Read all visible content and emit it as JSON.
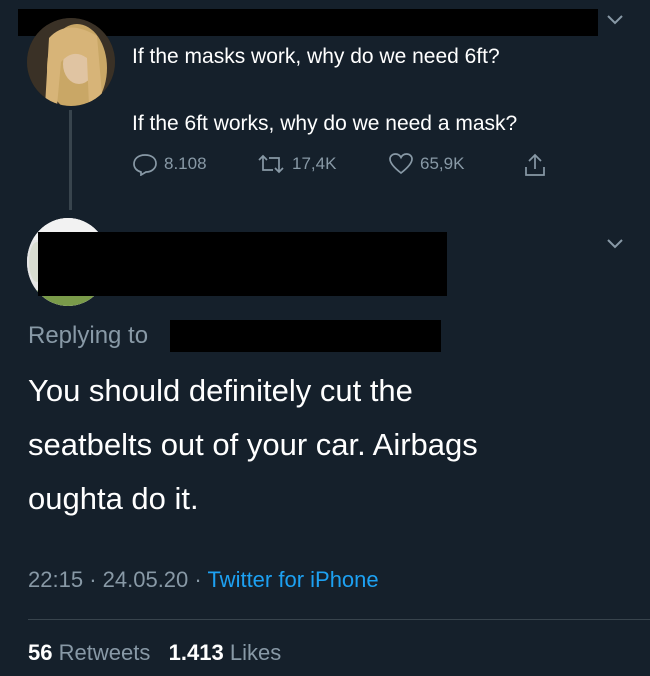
{
  "first_tweet": {
    "line1": "If the masks work, why do we need 6ft?",
    "line2": "If the 6ft works, why do we need a mask?",
    "actions": {
      "replies": "8.108",
      "retweets": "17,4K",
      "likes": "65,9K"
    }
  },
  "main_tweet": {
    "replying_to_label": "Replying to",
    "text_line1": "You should definitely cut the",
    "text_line2": "seatbelts out of your car. Airbags",
    "text_line3": "oughta do it.",
    "time": "22:15",
    "separator": "·",
    "date": "24.05.20",
    "source": "Twitter for iPhone",
    "retweets_count": "56",
    "retweets_label": "Retweets",
    "likes_count": "1.413",
    "likes_label": "Likes"
  },
  "colors": {
    "background": "#15202b",
    "secondary_text": "#8899a6",
    "link": "#1da1f2"
  }
}
